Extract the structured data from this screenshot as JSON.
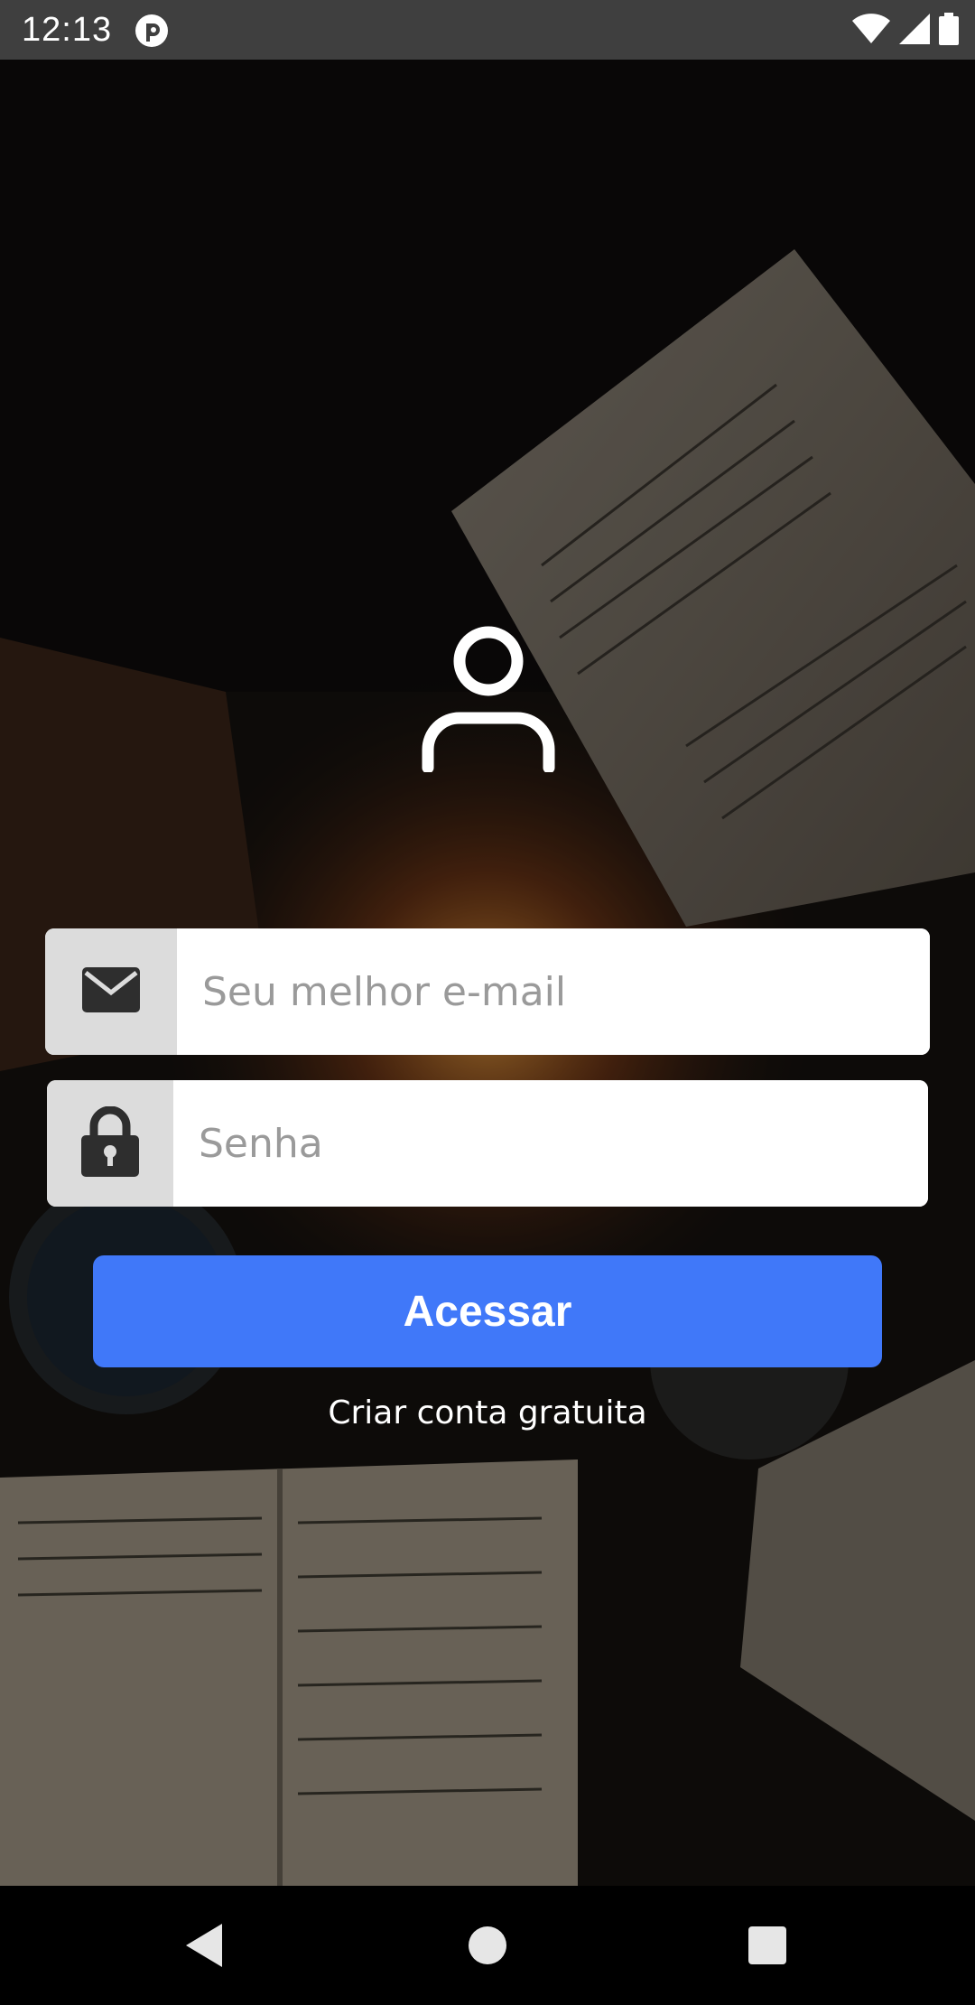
{
  "status_bar": {
    "time": "12:13",
    "icons": [
      "app-notification-icon",
      "wifi-icon",
      "signal-icon",
      "battery-icon"
    ]
  },
  "login": {
    "email_placeholder": "Seu melhor e-mail",
    "email_value": "",
    "password_placeholder": "Senha",
    "password_value": "",
    "submit_label": "Acessar",
    "create_account_label": "Criar conta gratuita",
    "icons": [
      "user-icon",
      "envelope-icon",
      "lock-icon"
    ]
  },
  "nav_bar": {
    "icons": [
      "back-icon",
      "home-icon",
      "recents-icon"
    ]
  },
  "colors": {
    "accent": "#4078f9",
    "status_bar": "#3f3f3f",
    "addon_bg": "#dcdcdc"
  }
}
